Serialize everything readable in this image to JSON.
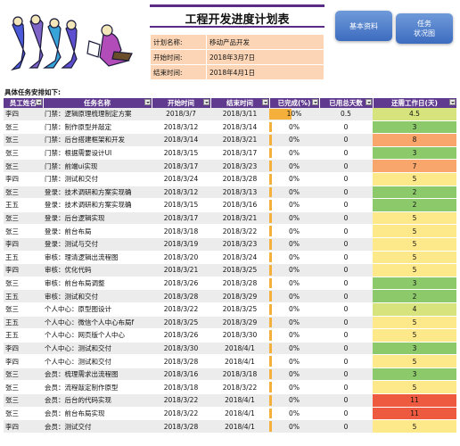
{
  "header": {
    "title": "工程开发进度计划表",
    "info": [
      {
        "label": "计划名称:",
        "value": "移动产品开发"
      },
      {
        "label": "开始时间:",
        "value": "2018年3月7日"
      },
      {
        "label": "结束时间:",
        "value": "2018年4月1日"
      }
    ]
  },
  "buttons": {
    "basic": "基本资料",
    "chart_line1": "任务",
    "chart_line2": "状况图"
  },
  "section_label": "具体任务安排如下:",
  "colors": {
    "header_purple": "#5f3a8e",
    "remaining_red": "#ee5a3f",
    "remaining_orange": "#f8a66c",
    "remaining_green": "#8cc96a",
    "remaining_lightgreen": "#d7e37c",
    "remaining_yellow": "#fee98a",
    "progress_bar": "#f4b03a"
  },
  "table": {
    "columns": [
      "员工姓名",
      "任务名称",
      "开始时间",
      "结束时间",
      "已完成(%)",
      "已用总天数",
      "还需工作日(天)"
    ],
    "rows": [
      {
        "name": "李四",
        "task": "门禁：逻辑原理梳理制定方案",
        "start": "2018/3/7",
        "end": "2018/3/11",
        "pct": "10%",
        "pct_value": 10,
        "used": "0.5",
        "remaining": "4.5",
        "color": "lightgreen"
      },
      {
        "name": "张三",
        "task": "门禁：制作原型并敲定",
        "start": "2018/3/12",
        "end": "2018/3/14",
        "pct": "0%",
        "pct_value": 0,
        "used": "0",
        "remaining": "3",
        "color": "green"
      },
      {
        "name": "张三",
        "task": "门禁：后台搭建框架和开发",
        "start": "2018/3/14",
        "end": "2018/3/21",
        "pct": "0%",
        "pct_value": 0,
        "used": "0",
        "remaining": "8",
        "color": "orange"
      },
      {
        "name": "张三",
        "task": "门禁：根据需要设计UI",
        "start": "2018/3/15",
        "end": "2018/3/17",
        "pct": "0%",
        "pct_value": 0,
        "used": "0",
        "remaining": "3",
        "color": "green"
      },
      {
        "name": "张三",
        "task": "门禁：前端ui实现",
        "start": "2018/3/17",
        "end": "2018/3/23",
        "pct": "0%",
        "pct_value": 0,
        "used": "0",
        "remaining": "7",
        "color": "orange"
      },
      {
        "name": "李四",
        "task": "门禁：测试和交付",
        "start": "2018/3/24",
        "end": "2018/3/28",
        "pct": "0%",
        "pct_value": 0,
        "used": "0",
        "remaining": "5",
        "color": "yellow"
      },
      {
        "name": "张三",
        "task": "登录：技术调研和方案实现确",
        "start": "2018/3/12",
        "end": "2018/3/13",
        "pct": "0%",
        "pct_value": 0,
        "used": "0",
        "remaining": "2",
        "color": "green"
      },
      {
        "name": "王五",
        "task": "登录：技术调研和方案实现确",
        "start": "2018/3/15",
        "end": "2018/3/16",
        "pct": "0%",
        "pct_value": 0,
        "used": "0",
        "remaining": "2",
        "color": "green"
      },
      {
        "name": "张三",
        "task": "登录：后台逻辑实现",
        "start": "2018/3/17",
        "end": "2018/3/21",
        "pct": "0%",
        "pct_value": 0,
        "used": "0",
        "remaining": "5",
        "color": "yellow"
      },
      {
        "name": "张三",
        "task": "登录：前台布局",
        "start": "2018/3/18",
        "end": "2018/3/22",
        "pct": "0%",
        "pct_value": 0,
        "used": "0",
        "remaining": "5",
        "color": "yellow"
      },
      {
        "name": "李四",
        "task": "登录：测试与交付",
        "start": "2018/3/19",
        "end": "2018/3/23",
        "pct": "0%",
        "pct_value": 0,
        "used": "0",
        "remaining": "5",
        "color": "yellow"
      },
      {
        "name": "王五",
        "task": "审核：理清逻辑出流程图",
        "start": "2018/3/20",
        "end": "2018/3/24",
        "pct": "0%",
        "pct_value": 0,
        "used": "0",
        "remaining": "5",
        "color": "yellow"
      },
      {
        "name": "李四",
        "task": "审核：优化代码",
        "start": "2018/3/21",
        "end": "2018/3/25",
        "pct": "0%",
        "pct_value": 0,
        "used": "0",
        "remaining": "5",
        "color": "yellow"
      },
      {
        "name": "张三",
        "task": "审核：前台布局调整",
        "start": "2018/3/26",
        "end": "2018/3/28",
        "pct": "0%",
        "pct_value": 0,
        "used": "0",
        "remaining": "3",
        "color": "green"
      },
      {
        "name": "王五",
        "task": "审核：测试和交付",
        "start": "2018/3/28",
        "end": "2018/3/29",
        "pct": "0%",
        "pct_value": 0,
        "used": "0",
        "remaining": "2",
        "color": "green"
      },
      {
        "name": "张三",
        "task": "个人中心：原型图设计",
        "start": "2018/3/22",
        "end": "2018/3/25",
        "pct": "0%",
        "pct_value": 0,
        "used": "0",
        "remaining": "4",
        "color": "lightgreen"
      },
      {
        "name": "王五",
        "task": "个人中心：微信个人中心布局f",
        "start": "2018/3/25",
        "end": "2018/3/29",
        "pct": "0%",
        "pct_value": 0,
        "used": "0",
        "remaining": "5",
        "color": "yellow"
      },
      {
        "name": "王五",
        "task": "个人中心：网页版个人中心",
        "start": "2018/3/26",
        "end": "2018/3/30",
        "pct": "0%",
        "pct_value": 0,
        "used": "0",
        "remaining": "5",
        "color": "yellow"
      },
      {
        "name": "李四",
        "task": "个人中心：测试和交付",
        "start": "2018/3/30",
        "end": "2018/4/1",
        "pct": "0%",
        "pct_value": 0,
        "used": "0",
        "remaining": "3",
        "color": "green"
      },
      {
        "name": "李四",
        "task": "个人中心：测试和交付",
        "start": "2018/3/28",
        "end": "2018/4/1",
        "pct": "0%",
        "pct_value": 0,
        "used": "0",
        "remaining": "5",
        "color": "yellow"
      },
      {
        "name": "张三",
        "task": "会员：梳理需求出流程图",
        "start": "2018/3/16",
        "end": "2018/3/18",
        "pct": "0%",
        "pct_value": 0,
        "used": "0",
        "remaining": "3",
        "color": "green"
      },
      {
        "name": "张三",
        "task": "会员：流程敲定制作原型",
        "start": "2018/3/18",
        "end": "2018/3/22",
        "pct": "0%",
        "pct_value": 0,
        "used": "0",
        "remaining": "5",
        "color": "yellow"
      },
      {
        "name": "张三",
        "task": "会员：后台的代码实现",
        "start": "2018/3/22",
        "end": "2018/4/1",
        "pct": "0%",
        "pct_value": 0,
        "used": "0",
        "remaining": "11",
        "color": "red"
      },
      {
        "name": "张三",
        "task": "会员：前台布局实现",
        "start": "2018/3/22",
        "end": "2018/4/1",
        "pct": "0%",
        "pct_value": 0,
        "used": "0",
        "remaining": "11",
        "color": "red"
      },
      {
        "name": "李四",
        "task": "会员：测试交付",
        "start": "2018/3/28",
        "end": "2018/4/1",
        "pct": "0%",
        "pct_value": 0,
        "used": "0",
        "remaining": "5",
        "color": "yellow"
      }
    ]
  }
}
